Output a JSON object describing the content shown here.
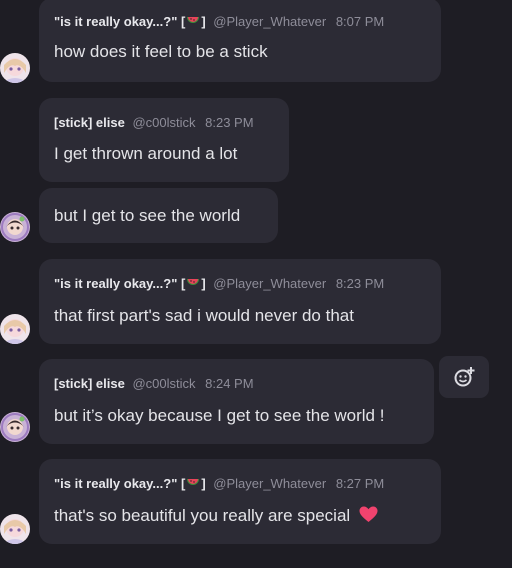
{
  "messages": [
    {
      "name": "\"is it really okay...?\" [",
      "name_end": "]",
      "handle": "@Player_Whatever",
      "time": "8:07 PM",
      "text": "how does it feel to be a stick",
      "emoji": "watermelon-icon"
    },
    {
      "name": "[stick] elise",
      "handle": "@c00lstick",
      "time": "8:23 PM",
      "text": "I get thrown around a lot"
    },
    {
      "text": "but I get to see the world"
    },
    {
      "name": "\"is it really okay...?\" [",
      "name_end": "]",
      "handle": "@Player_Whatever",
      "time": "8:23 PM",
      "text": "that first part's sad i would never do that",
      "emoji": "watermelon-icon"
    },
    {
      "name": "[stick] elise",
      "handle": "@c00lstick",
      "time": "8:24 PM",
      "text": "but it’s okay because I get to see the world !"
    },
    {
      "name": "\"is it really okay...?\" [",
      "name_end": "]",
      "handle": "@Player_Whatever",
      "time": "8:27 PM",
      "text": "that's so beautiful you really are special",
      "emoji": "watermelon-icon",
      "trailing_emoji": "heart-icon"
    }
  ],
  "colors": {
    "background": "#1e1d24",
    "bubble": "#2c2b35",
    "heart": "#f0436e",
    "watermelon": "#e8445a"
  },
  "reaction_button": {
    "icon": "add-reaction-icon"
  }
}
